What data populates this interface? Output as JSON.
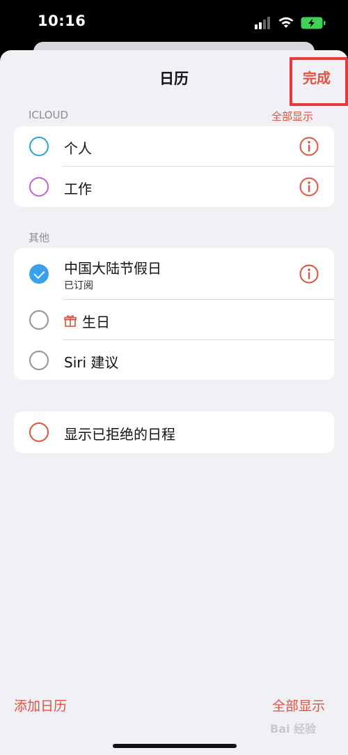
{
  "status_bar": {
    "time": "10:16"
  },
  "nav": {
    "title": "日历",
    "done": "完成"
  },
  "icloud": {
    "header": "ICLOUD",
    "action": "全部显示",
    "items": [
      {
        "label": "个人",
        "color": "#2aa6cf"
      },
      {
        "label": "工作",
        "color": "#b865d6"
      }
    ]
  },
  "other": {
    "header": "其他",
    "items": [
      {
        "label": "中国大陆节假日",
        "subtitle": "已订阅",
        "checked": true
      },
      {
        "label": "生日",
        "icon": "gift-icon"
      },
      {
        "label": "Siri 建议"
      }
    ]
  },
  "declined": {
    "label": "显示已拒绝的日程",
    "color": "#e0513f"
  },
  "bottom": {
    "add": "添加日历",
    "show_all": "全部显示"
  },
  "watermark": "Bai 经验",
  "colors": {
    "accent": "#e0513f",
    "check": "#3aa0ee",
    "background": "#f1f0f5"
  }
}
